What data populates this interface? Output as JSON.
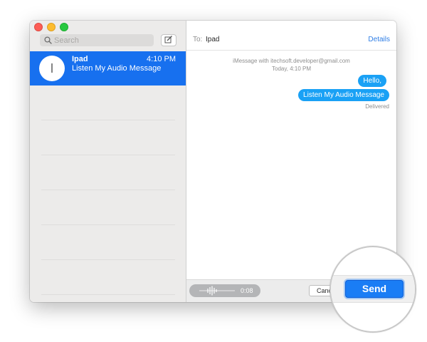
{
  "sidebar": {
    "search_placeholder": "Search",
    "conversations": [
      {
        "initial": "I",
        "name": "Ipad",
        "time": "4:10 PM",
        "preview": "Listen My Audio Message"
      }
    ]
  },
  "header": {
    "to_label": "To:",
    "recipient": "Ipad",
    "details_label": "Details"
  },
  "thread": {
    "service_line": "iMessage with itechsoft.developer@gmail.com",
    "date_line": "Today, 4:10 PM",
    "messages": [
      {
        "text": "Hello,"
      },
      {
        "text": "Listen My Audio Message"
      }
    ],
    "status": "Delivered"
  },
  "compose_bar": {
    "audio_duration": "0:08",
    "cancel_label": "Cancel",
    "send_label": "Send"
  },
  "colors": {
    "selection_blue": "#1770ef",
    "bubble_blue": "#1aa1f5",
    "send_blue": "#1a7df5"
  },
  "icons": [
    "search-icon",
    "compose-icon",
    "audio-waveform-icon"
  ]
}
